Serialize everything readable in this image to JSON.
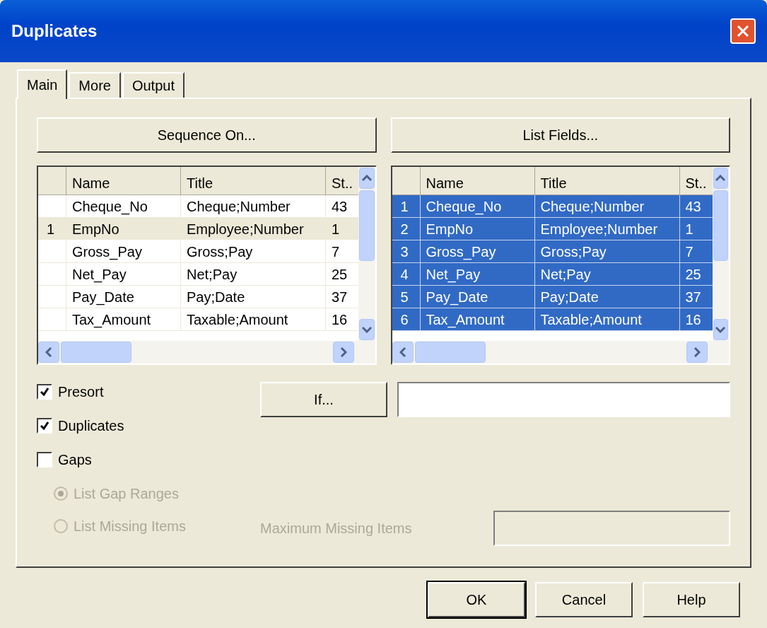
{
  "window": {
    "title": "Duplicates"
  },
  "tabs": [
    {
      "label": "Main",
      "selected": true
    },
    {
      "label": "More",
      "selected": false
    },
    {
      "label": "Output",
      "selected": false
    }
  ],
  "buttons_top": [
    "Sequence On...",
    "List Fields..."
  ],
  "tables": [
    {
      "columns": [
        "Name",
        "Title",
        "St.."
      ],
      "rows": [
        {
          "seq": "",
          "cells": [
            "Cheque_No",
            "Cheque;Number",
            "43"
          ],
          "selected": false
        },
        {
          "seq": "1",
          "cells": [
            "EmpNo",
            "Employee;Number",
            "1"
          ],
          "selected": false
        },
        {
          "seq": "",
          "cells": [
            "Gross_Pay",
            "Gross;Pay",
            "7"
          ],
          "selected": false
        },
        {
          "seq": "",
          "cells": [
            "Net_Pay",
            "Net;Pay",
            "25"
          ],
          "selected": false
        },
        {
          "seq": "",
          "cells": [
            "Pay_Date",
            "Pay;Date",
            "37"
          ],
          "selected": false
        },
        {
          "seq": "",
          "cells": [
            "Tax_Amount",
            "Taxable;Amount",
            "16"
          ],
          "selected": false
        }
      ]
    },
    {
      "columns": [
        "Name",
        "Title",
        "St.."
      ],
      "rows": [
        {
          "seq": "1",
          "cells": [
            "Cheque_No",
            "Cheque;Number",
            "43"
          ],
          "selected": true
        },
        {
          "seq": "2",
          "cells": [
            "EmpNo",
            "Employee;Number",
            "1"
          ],
          "selected": true
        },
        {
          "seq": "3",
          "cells": [
            "Gross_Pay",
            "Gross;Pay",
            "7"
          ],
          "selected": true
        },
        {
          "seq": "4",
          "cells": [
            "Net_Pay",
            "Net;Pay",
            "25"
          ],
          "selected": true
        },
        {
          "seq": "5",
          "cells": [
            "Pay_Date",
            "Pay;Date",
            "37"
          ],
          "selected": true
        },
        {
          "seq": "6",
          "cells": [
            "Tax_Amount",
            "Taxable;Amount",
            "16"
          ],
          "selected": true
        }
      ]
    }
  ],
  "checkboxes": [
    {
      "label": "Presort",
      "checked": true
    },
    {
      "label": "Duplicates",
      "checked": true
    },
    {
      "label": "Gaps",
      "checked": false
    }
  ],
  "radios": [
    {
      "label": "List Gap Ranges",
      "selected": true,
      "disabled": true
    },
    {
      "label": "List Missing Items",
      "selected": false,
      "disabled": true
    }
  ],
  "if_button": "If...",
  "max_missing": {
    "label": "Maximum Missing Items",
    "disabled": true
  },
  "buttons_bottom": [
    "OK",
    "Cancel",
    "Help"
  ]
}
